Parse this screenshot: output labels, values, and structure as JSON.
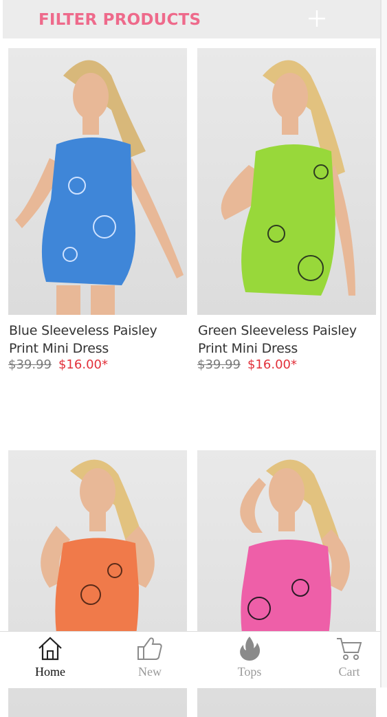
{
  "filter": {
    "title": "FILTER PRODUCTS",
    "icon": "plus-icon",
    "accent_color": "#ee6a8b"
  },
  "products": [
    {
      "title": "Blue Sleeveless Paisley Print Mini Dress",
      "old_price": "$39.99",
      "price": "$16.00*",
      "dress_color": "#3f86d8"
    },
    {
      "title": "Green Sleeveless Paisley Print Mini Dress",
      "old_price": "$39.99",
      "price": "$16.00*",
      "dress_color": "#98d83a"
    },
    {
      "title": "",
      "old_price": "",
      "price": "",
      "dress_color": "#f07a4a"
    },
    {
      "title": "",
      "old_price": "",
      "price": "",
      "dress_color": "#ee5fa8"
    }
  ],
  "nav": {
    "items": [
      {
        "label": "Home",
        "icon": "home-icon",
        "active": true
      },
      {
        "label": "New",
        "icon": "thumbs-up-icon",
        "active": false
      },
      {
        "label": "Tops",
        "icon": "flame-icon",
        "active": false
      },
      {
        "label": "Cart",
        "icon": "cart-icon",
        "active": false
      }
    ]
  },
  "colors": {
    "sale_price": "#e2303a",
    "old_price": "#7a7a7a"
  }
}
